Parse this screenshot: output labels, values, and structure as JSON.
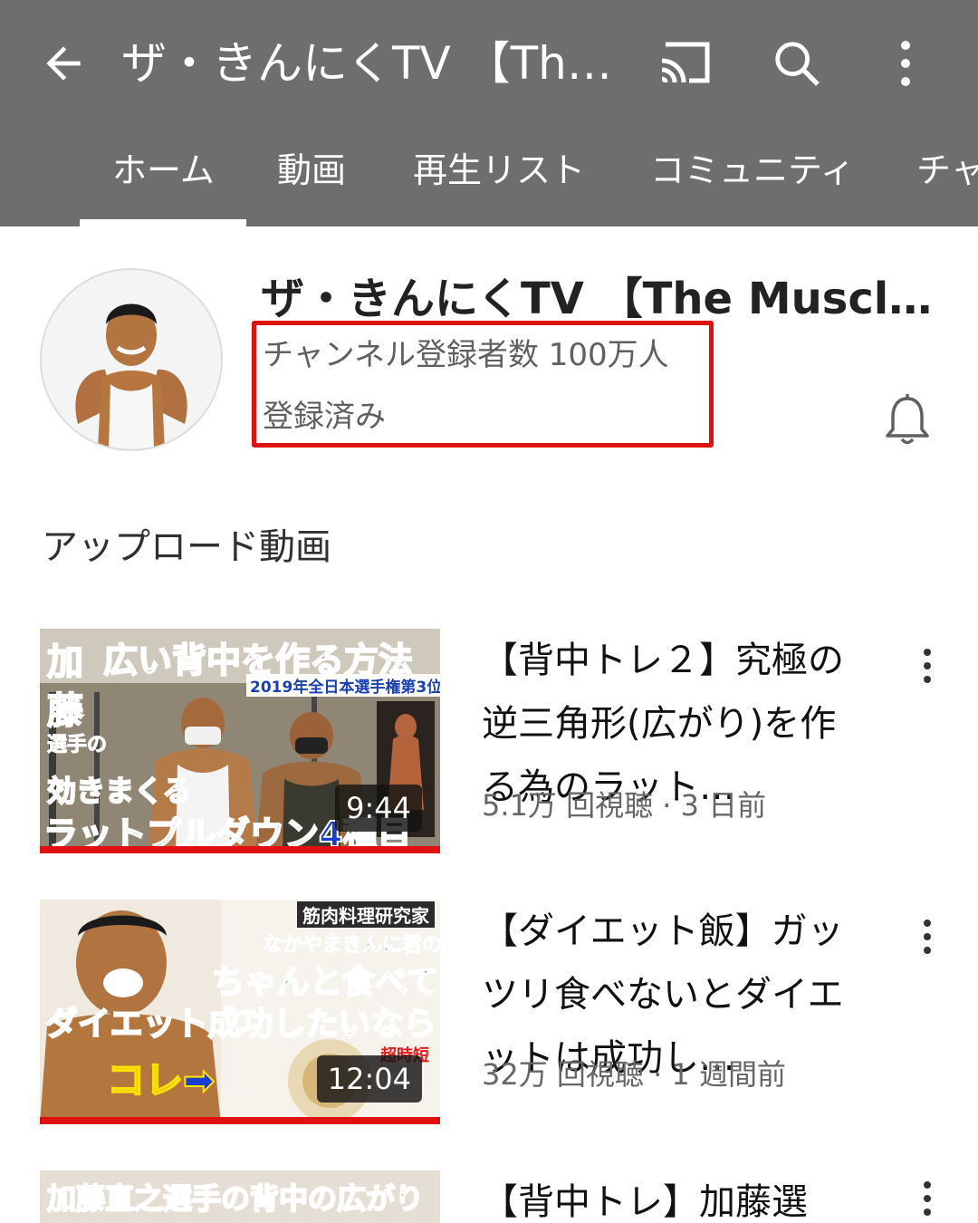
{
  "app_bar": {
    "title": "ザ・きんにくTV 【The…",
    "icons": [
      "back-arrow-icon",
      "cast-icon",
      "search-icon",
      "more-vert-icon"
    ],
    "background": "#6e6e6e"
  },
  "tabs": [
    {
      "label": "ホーム",
      "selected": true
    },
    {
      "label": "動画"
    },
    {
      "label": "再生リスト"
    },
    {
      "label": "コミュニティ"
    },
    {
      "label": "チャ"
    }
  ],
  "channel": {
    "name": "ザ・きんにくTV 【The Muscl…",
    "subscribers": "チャンネル登録者数 100万人",
    "subscribed_label": "登録済み",
    "highlight_color": "#e21111"
  },
  "section": {
    "title": "アップロード動画"
  },
  "videos": [
    {
      "title": "【背中トレ２】究極の逆三角形(広がり)を作る為のラット…",
      "views": "5.1万 回視聴",
      "age": "3 日前",
      "duration": "9:44",
      "thumb_text": {
        "top": "広い背中を作る方法",
        "side1": "加",
        "side2": "藤",
        "side3": "選手の",
        "badge": "2019年全日本選手権第3位",
        "mid": "効きまくる",
        "bottom": "ラットプルダウン4種目"
      }
    },
    {
      "title": "【ダイエット飯】ガッツリ食べないとダイエットは成功し…",
      "views": "32万 回視聴",
      "age": "1 週間前",
      "duration": "12:04",
      "thumb_text": {
        "badge": "筋肉料理研究家",
        "line1": "なかやまきんに君の",
        "line2": "ちゃんと食べて",
        "line3": "ダイエット成功したいなら",
        "line4": "コレ➡",
        "tag": "超時短"
      }
    },
    {
      "title": "【背中トレ】加藤選",
      "thumb_text": {
        "top": "加藤直之選手の背中の広がり"
      }
    }
  ]
}
